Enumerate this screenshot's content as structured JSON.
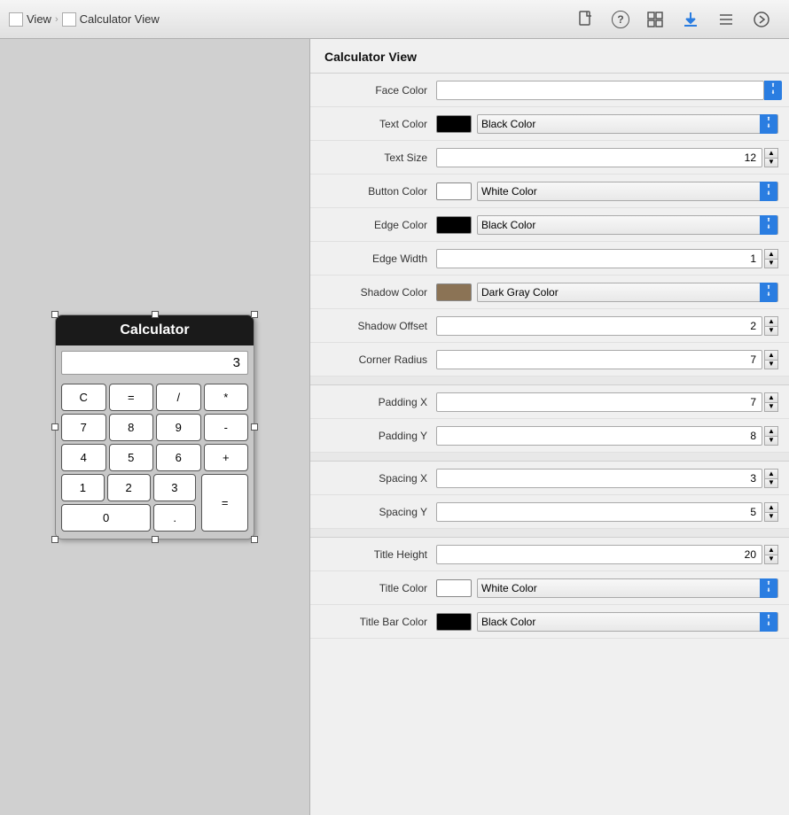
{
  "toolbar": {
    "breadcrumb": [
      {
        "label": "View",
        "icon": "view-icon"
      },
      {
        "label": "Calculator View",
        "icon": "calc-icon"
      }
    ],
    "icons": [
      {
        "name": "file-icon",
        "symbol": "📄",
        "active": false
      },
      {
        "name": "help-icon",
        "symbol": "?",
        "active": false
      },
      {
        "name": "grid-icon",
        "symbol": "⊞",
        "active": false
      },
      {
        "name": "download-icon",
        "symbol": "⬇",
        "active": true
      },
      {
        "name": "list-icon",
        "symbol": "≡",
        "active": false
      },
      {
        "name": "arrow-icon",
        "symbol": "→",
        "active": false
      }
    ]
  },
  "panel": {
    "title": "Calculator View"
  },
  "calculator": {
    "title": "Calculator",
    "display": "3",
    "buttons": [
      [
        "C",
        "=",
        "/",
        "*"
      ],
      [
        "7",
        "8",
        "9",
        "-"
      ],
      [
        "4",
        "5",
        "6",
        "+"
      ],
      [
        "1",
        "2",
        "3",
        "=wide"
      ],
      [
        "0wide",
        ".",
        ""
      ]
    ]
  },
  "properties": {
    "face_color_label": "Face Color",
    "text_color_label": "Text Color",
    "text_color_value": "Black Color",
    "text_color_swatch": "#000000",
    "text_size_label": "Text Size",
    "text_size_value": "12",
    "button_color_label": "Button Color",
    "button_color_value": "White Color",
    "button_color_swatch": "#ffffff",
    "edge_color_label": "Edge Color",
    "edge_color_value": "Black Color",
    "edge_color_swatch": "#000000",
    "edge_width_label": "Edge Width",
    "edge_width_value": "1",
    "shadow_color_label": "Shadow Color",
    "shadow_color_value": "Dark Gray Color",
    "shadow_color_swatch": "#8b7355",
    "shadow_offset_label": "Shadow Offset",
    "shadow_offset_value": "2",
    "corner_radius_label": "Corner Radius",
    "corner_radius_value": "7",
    "padding_x_label": "Padding X",
    "padding_x_value": "7",
    "padding_y_label": "Padding Y",
    "padding_y_value": "8",
    "spacing_x_label": "Spacing X",
    "spacing_x_value": "3",
    "spacing_y_label": "Spacing Y",
    "spacing_y_value": "5",
    "title_height_label": "Title Height",
    "title_height_value": "20",
    "title_color_label": "Title Color",
    "title_color_value": "White Color",
    "title_color_swatch": "#ffffff",
    "title_bar_color_label": "Title Bar Color",
    "title_bar_color_value": "Black Color",
    "title_bar_color_swatch": "#000000"
  }
}
